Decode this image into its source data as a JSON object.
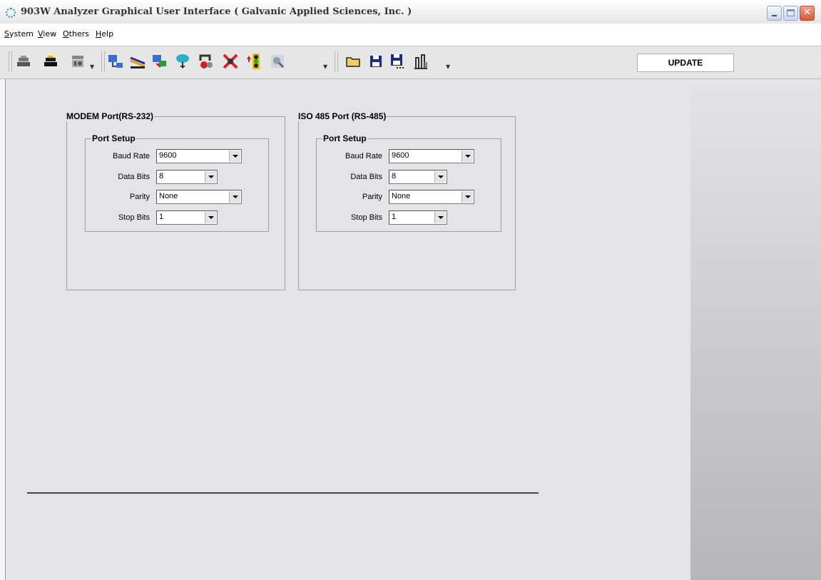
{
  "window": {
    "title": "903W Analyzer Graphical User Interface  ( Galvanic Applied Sciences, Inc. )"
  },
  "menu": {
    "items": [
      "System",
      "View",
      "Others",
      "Help"
    ]
  },
  "toolbar": {
    "update_label": "UPDATE",
    "buttons": [
      "connect-icon",
      "disconnect-icon",
      "modem-icon",
      "download-icon",
      "analyzer-icon",
      "transfer-icon",
      "sensor-icon",
      "reset-icon",
      "stop-icon",
      "status-light-icon",
      "diagnostics-icon",
      "open-folder-icon",
      "save-icon",
      "save-as-icon",
      "chart-icon"
    ]
  },
  "modem_port": {
    "title": "MODEM Port(RS-232)",
    "setup_title": "Port Setup",
    "baud_label": "Baud Rate",
    "baud_value": "9600",
    "databits_label": "Data Bits",
    "databits_value": "8",
    "parity_label": "Parity",
    "parity_value": "None",
    "stopbits_label": "Stop Bits",
    "stopbits_value": "1"
  },
  "iso_port": {
    "title": "ISO 485 Port (RS-485)",
    "setup_title": "Port Setup",
    "baud_label": "Baud Rate",
    "baud_value": "9600",
    "databits_label": "Data Bits",
    "databits_value": "8",
    "parity_label": "Parity",
    "parity_value": "None",
    "stopbits_label": "Stop Bits",
    "stopbits_value": "1"
  }
}
